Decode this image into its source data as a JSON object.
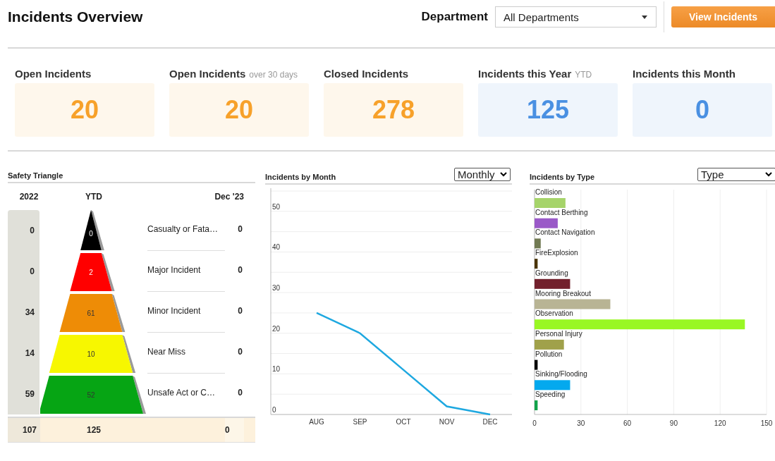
{
  "header": {
    "title": "Incidents Overview",
    "department_label": "Department",
    "department_value": "All Departments",
    "button": "View Incidents"
  },
  "kpis": [
    {
      "label": "Open Incidents",
      "value": "20",
      "color": "#f7a12a"
    },
    {
      "label": "Open Incidents",
      "note": "over 30 days",
      "value": "20",
      "color": "#f7a12a"
    },
    {
      "label": "Closed Incidents",
      "value": "278",
      "color": "#f7a12a"
    },
    {
      "label": "Incidents this Year",
      "note": "YTD",
      "value": "125",
      "color": "#4a90e2"
    },
    {
      "label": "Incidents this Month",
      "value": "0",
      "color": "#4a90e2"
    }
  ],
  "safety_triangle": {
    "title": "Safety Triangle",
    "columns": [
      "2022",
      "YTD",
      "Dec '23"
    ],
    "rows": [
      {
        "prior": "0",
        "ytd": "0",
        "label": "Casualty or Fata…",
        "current": "0",
        "color": "#000000"
      },
      {
        "prior": "0",
        "ytd": "2",
        "label": "Major Incident",
        "current": "0",
        "color": "#ff0000"
      },
      {
        "prior": "34",
        "ytd": "61",
        "label": "Minor Incident",
        "current": "0",
        "color": "#ee8c06"
      },
      {
        "prior": "14",
        "ytd": "10",
        "label": "Near Miss",
        "current": "0",
        "color": "#f7f700"
      },
      {
        "prior": "59",
        "ytd": "52",
        "label": "Unsafe Act or C…",
        "current": "0",
        "color": "#06a514"
      }
    ],
    "totals": {
      "prior": "107",
      "ytd": "125",
      "current": "0"
    }
  },
  "by_month": {
    "title": "Incidents by Month",
    "period": "Monthly",
    "chart_data": {
      "type": "line",
      "categories": [
        "AUG",
        "SEP",
        "OCT",
        "NOV",
        "DEC"
      ],
      "series": [
        {
          "color": "#1ea8e0",
          "values": [
            25,
            20,
            11,
            2,
            0
          ]
        }
      ],
      "grid": true,
      "ylim": [
        0,
        55
      ],
      "yticks": [
        0,
        10,
        20,
        30,
        40,
        50
      ]
    }
  },
  "by_type": {
    "title": "Incidents by Type",
    "grouping": "Type",
    "chart_data": {
      "type": "bar",
      "orientation": "horizontal",
      "categories": [
        "Collision",
        "Contact Berthing",
        "Contact Navigation",
        "FireExplosion",
        "Grounding",
        "Mooring Breakout",
        "Observation",
        "Personal Injury",
        "Pollution",
        "Sinking/Flooding",
        "Speeding"
      ],
      "series": [
        {
          "values": [
            20,
            15,
            4,
            2,
            23,
            49,
            136,
            19,
            2,
            23,
            2
          ]
        }
      ],
      "grid": true,
      "colors": [
        "#a6d46a",
        "#9a59c8",
        "#717a53",
        "#4a3405",
        "#72202c",
        "#b8b494",
        "#99f724",
        "#a0a14a",
        "#000000",
        "#04a9ee",
        "#11a34a"
      ],
      "xlim": [
        0,
        150
      ],
      "xticks": [
        0,
        30,
        60,
        90,
        120,
        150
      ]
    }
  }
}
